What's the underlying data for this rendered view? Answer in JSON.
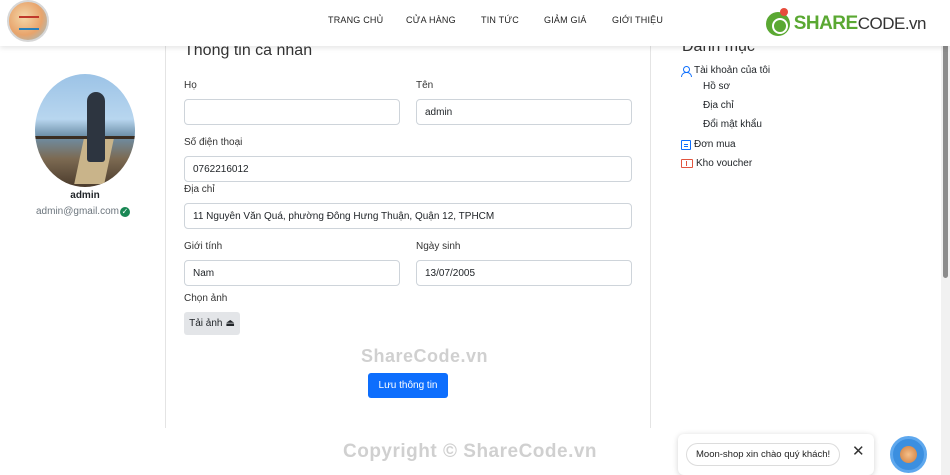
{
  "nav": {
    "items": [
      "TRANG CHỦ",
      "CỬA HÀNG",
      "TIN TỨC",
      "GIẢM GIÁ",
      "GIỚI THIỆU"
    ]
  },
  "brand_logo": {
    "part1": "SHARE",
    "part2": "CODE.vn"
  },
  "profile": {
    "name": "admin",
    "email": "admin@gmail.com"
  },
  "form": {
    "title": "Thông tin cá nhân",
    "ho_label": "Họ",
    "ho_value": "",
    "ten_label": "Tên",
    "ten_value": "admin",
    "phone_label": "Số điện thoại",
    "phone_value": "0762216012",
    "address_label": "Địa chỉ",
    "address_value": "11 Nguyễn Văn Quá, phường Đông Hưng Thuận, Quận 12, TPHCM",
    "gender_label": "Giới tính",
    "gender_value": "Nam",
    "dob_label": "Ngày sinh",
    "dob_value": "13/07/2005",
    "image_label": "Chọn ảnh",
    "upload_label": "Tải ảnh",
    "save_label": "Lưu thông tin"
  },
  "watermarks": {
    "center": "ShareCode.vn",
    "footer": "Copyright © ShareCode.vn"
  },
  "categories": {
    "title": "Danh mục",
    "account": "Tài khoản của tôi",
    "profile": "Hồ sơ",
    "address": "Địa chỉ",
    "password": "Đổi mật khẩu",
    "orders": "Đơn mua",
    "vouchers": "Kho voucher"
  },
  "chat": {
    "greeting": "Moon-shop xin chào quý khách!",
    "close": "✕"
  },
  "colors": {
    "primary": "#0d6efd",
    "verified": "#198754",
    "sharecode_green": "#5aa832"
  }
}
